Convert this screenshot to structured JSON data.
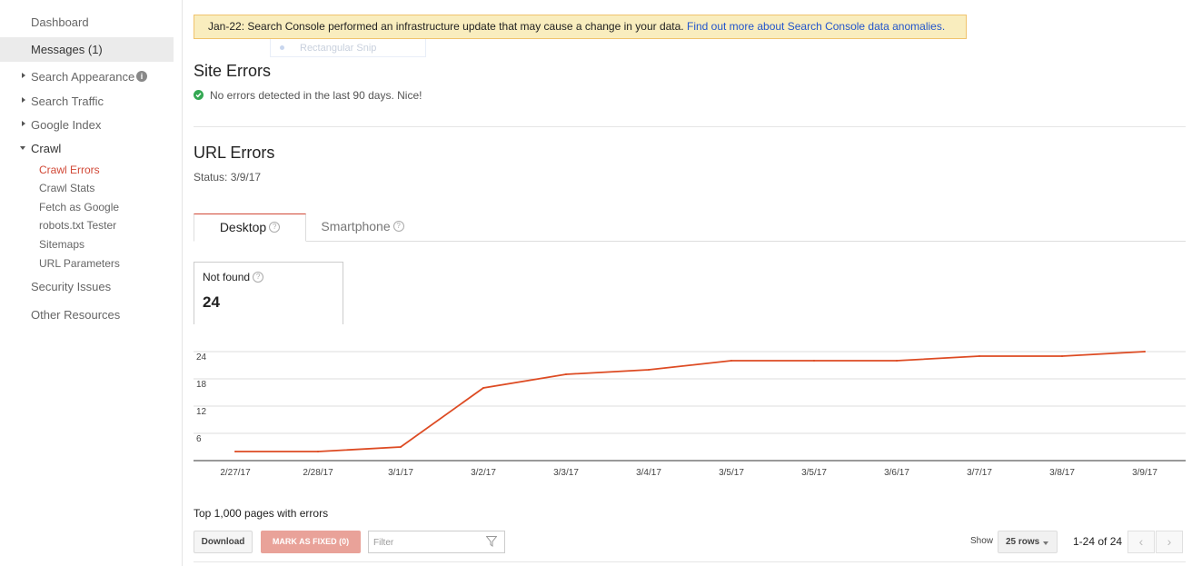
{
  "sidebar": {
    "dashboard": "Dashboard",
    "messages": "Messages (1)",
    "search_appearance": "Search Appearance",
    "search_traffic": "Search Traffic",
    "google_index": "Google Index",
    "crawl": "Crawl",
    "crawl_items": [
      "Crawl Errors",
      "Crawl Stats",
      "Fetch as Google",
      "robots.txt Tester",
      "Sitemaps",
      "URL Parameters"
    ],
    "security_issues": "Security Issues",
    "other_resources": "Other Resources"
  },
  "notice": {
    "text": "Jan-22: Search Console performed an infrastructure update that may cause a change in your data.",
    "link": "Find out more about Search Console data anomalies."
  },
  "ghost_snip": "Rectangular Snip",
  "site_errors": {
    "title": "Site Errors",
    "status": "No errors detected in the last 90 days. Nice!"
  },
  "url_errors": {
    "title": "URL Errors",
    "status": "Status: 3/9/17",
    "tabs": [
      "Desktop",
      "Smartphone"
    ],
    "metric_label": "Not found",
    "metric_value": "24"
  },
  "chart_data": {
    "type": "line",
    "x": [
      "2/27/17",
      "2/28/17",
      "3/1/17",
      "3/2/17",
      "3/3/17",
      "3/4/17",
      "3/5/17",
      "3/5/17",
      "3/6/17",
      "3/7/17",
      "3/8/17",
      "3/9/17"
    ],
    "series": [
      {
        "name": "Not found",
        "values": [
          2,
          2,
          3,
          16,
          19,
          20,
          22,
          22,
          22,
          23,
          23,
          24
        ]
      }
    ],
    "yticks": [
      6,
      12,
      18,
      24
    ],
    "ylim": [
      0,
      25
    ],
    "grid": true,
    "color": "#dd4b23"
  },
  "table_controls": {
    "heading": "Top 1,000 pages with errors",
    "download": "Download",
    "mark_fixed": "MARK AS FIXED (0)",
    "filter_placeholder": "Filter",
    "show_label": "Show",
    "rows": "25 rows",
    "range": "1-24 of 24"
  }
}
